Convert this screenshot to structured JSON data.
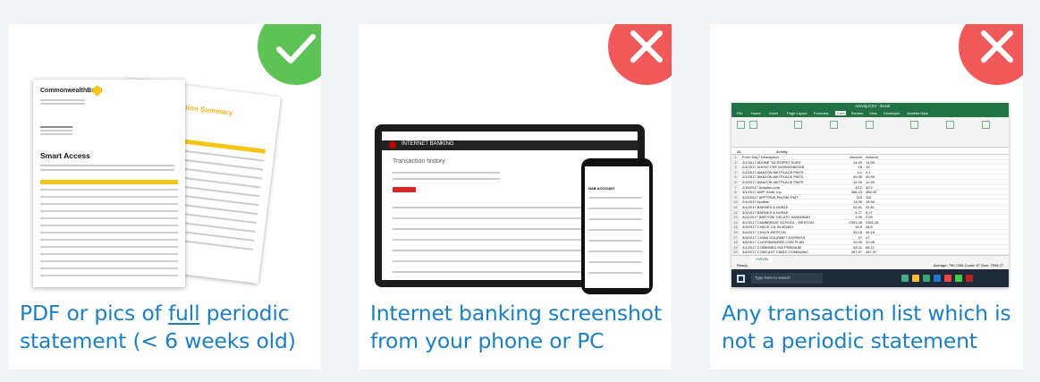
{
  "cards": [
    {
      "caption_pre": "PDF or pics of ",
      "caption_under": "full",
      "caption_post": " periodic statement (< 6 weeks old)",
      "badge": "check-icon",
      "badge_color": "#5ec257",
      "image": {
        "logo": "CommonwealthBank",
        "statement_title": "Smart Access",
        "summary_title": "Transaction Summary"
      }
    },
    {
      "caption": "Internet banking screenshot from your phone or PC",
      "badge": "close-icon",
      "badge_color": "#f0595a",
      "image": {
        "header": "INTERNET BANKING",
        "page_title": "Transaction history",
        "phone_section": "NAB ACCOUNT"
      }
    },
    {
      "caption": "Any transaction list which is not a periodic statement",
      "badge": "close-icon",
      "badge_color": "#f0595a",
      "image": {
        "window_title": "Activity.CSV - Excel",
        "tabs": [
          "File",
          "Home",
          "Insert",
          "Page Layout",
          "Formulas",
          "Data",
          "Review",
          "View",
          "Developer",
          "Ablebits Data"
        ],
        "name_box": "A1",
        "formula_value": "Activity",
        "sheet_tab": "Activity",
        "status": "Ready",
        "status_right": "Average: 790.7285  Count: 67  Sum: 7908.77",
        "search_placeholder": "Type here to search",
        "rows": [
          {
            "d": "Form Day / Description",
            "a": "Amount",
            "b": "Amount"
          },
          {
            "d": "2/1/2017 ADOBE *ACROPRO SUBS",
            "a": "14.99",
            "b": "14.99"
          },
          {
            "d": "2/4/2017 AGENT FEE 0000000462328",
            "a": "15",
            "b": "15"
          },
          {
            "d": "2/1/2017 AMAZON MKTPLACE PMTS",
            "a": "4.1",
            "b": "4.1"
          },
          {
            "d": "2/1/2017 AMAZON MKTPLACE PMTS",
            "a": "49.95",
            "b": "49.95"
          },
          {
            "d": "2/3/2017 AMAZON MKTPLACE PMTS",
            "a": "12.99",
            "b": "12.99"
          },
          {
            "d": "2/16/2017 Amazon.com",
            "a": "43.2",
            "b": "43.2"
          },
          {
            "d": "3/1/2017 AMP Youth, Inc.",
            "a": "486.43",
            "b": "486.43"
          },
          {
            "d": "3/22/2017 APPTRUE PHONE PMT",
            "a": "110",
            "b": "110"
          },
          {
            "d": "2/4/2017 Audible",
            "a": "14.95",
            "b": "14.95"
          },
          {
            "d": "3/1/2017 BARNES & NOBLE",
            "a": "42.81",
            "b": "42.81"
          },
          {
            "d": "3/3/2017 BARNES & NOBLE",
            "a": "5.27",
            "b": "5.27"
          },
          {
            "d": "3/21/2017 BERTONI GELATO SAVANNAH",
            "a": "3.99",
            "b": "3.99"
          },
          {
            "d": "3/1/2017 CAMBRIDGE SCHOOL - WESTON",
            "a": "2391.28",
            "b": "2391.28"
          },
          {
            "d": "3/3/2017 CHECK CIL IN #02822",
            "a": "28.5",
            "b": "28.5"
          },
          {
            "d": "3/4/2017 CHILI'S WESTON",
            "a": "35.18",
            "b": "35.18"
          },
          {
            "d": "3/3/2017 CHINA GOURMET EXPRESS",
            "a": "47",
            "b": "47"
          },
          {
            "d": "3/6/2017 CLASSMANDER.COM PLAN",
            "a": "20.95",
            "b": "20.95"
          },
          {
            "d": "3/1/2017 COMBINED INS PREMIUM",
            "a": "68.11",
            "b": "68.11"
          },
          {
            "d": "3/4/2017 COMCAST CABLE COMMUNIC",
            "a": "267.97",
            "b": "267.97"
          }
        ]
      }
    }
  ]
}
